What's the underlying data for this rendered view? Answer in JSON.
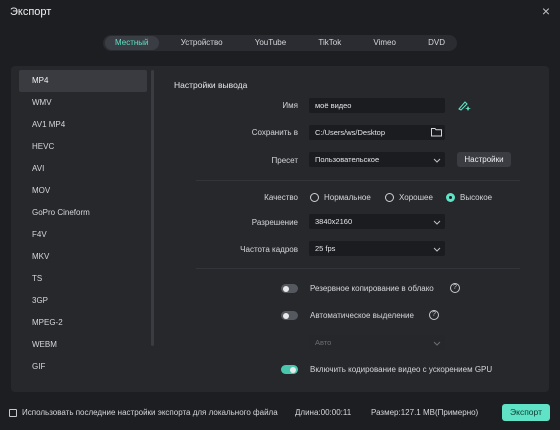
{
  "window": {
    "title": "Экспорт",
    "close_glyph": "×"
  },
  "tabs": [
    {
      "label": "Местный",
      "active": true
    },
    {
      "label": "Устройство"
    },
    {
      "label": "YouTube"
    },
    {
      "label": "TikTok"
    },
    {
      "label": "Vimeo"
    },
    {
      "label": "DVD"
    }
  ],
  "formats": [
    "MP4",
    "WMV",
    "AV1 MP4",
    "HEVC",
    "AVI",
    "MOV",
    "GoPro Cineform",
    "F4V",
    "MKV",
    "TS",
    "3GP",
    "MPEG-2",
    "WEBM",
    "GIF"
  ],
  "selected_format": "MP4",
  "settings": {
    "section_title": "Настройки вывода",
    "name_label": "Имя",
    "name_value": "моё видео",
    "save_label": "Сохранить в",
    "save_value": "C:/Users/ws/Desktop",
    "preset_label": "Пресет",
    "preset_value": "Пользовательское",
    "settings_button": "Настройки",
    "quality_label": "Качество",
    "quality_options": [
      "Нормальное",
      "Хорошее",
      "Высокое"
    ],
    "quality_selected": "Высокое",
    "resolution_label": "Разрешение",
    "resolution_value": "3840x2160",
    "framerate_label": "Частота кадров",
    "framerate_value": "25 fps",
    "cloud_backup_label": "Резервное копирование в облако",
    "auto_highlight_label": "Автоматическое выделение",
    "auto_value": "Авто",
    "gpu_label": "Включить кодирование видео с ускорением GPU",
    "cloud_backup_on": false,
    "auto_highlight_on": false,
    "gpu_on": true
  },
  "footer": {
    "remember_label": "Использовать последние настройки экспорта для локального файла",
    "duration": "Длина:00:00:11",
    "size": "Размер:127.1 MB(Примерно)",
    "export_button": "Экспорт"
  },
  "colors": {
    "accent": "#5fe2c5",
    "background": "#1d1e22",
    "panel": "#26282c"
  }
}
